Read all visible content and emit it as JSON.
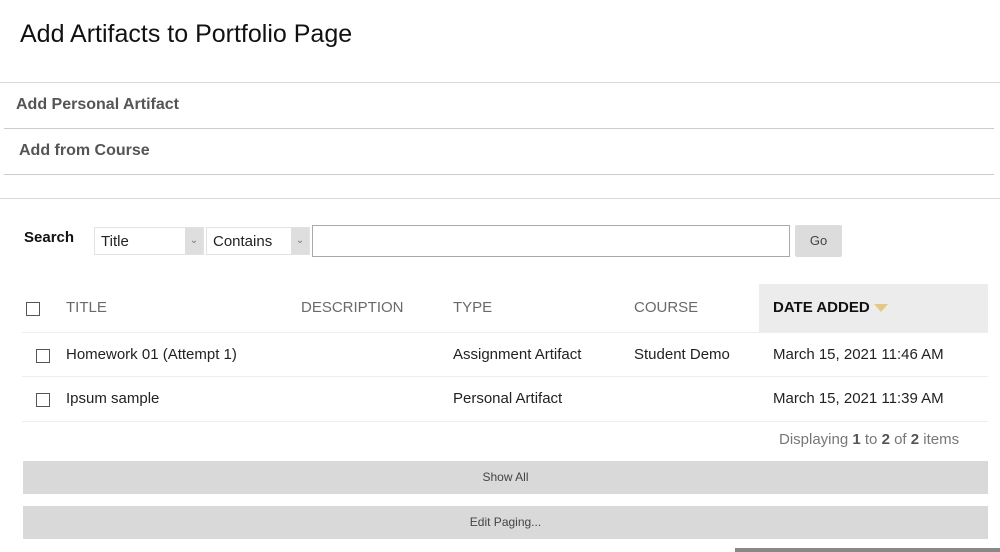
{
  "page": {
    "title": "Add Artifacts to Portfolio Page"
  },
  "actions": {
    "add_personal": "Add Personal Artifact",
    "add_from_course": "Add from Course"
  },
  "search": {
    "label": "Search",
    "field_select": "Title",
    "operator_select": "Contains",
    "input_value": "",
    "go_label": "Go"
  },
  "table": {
    "columns": [
      "TITLE",
      "DESCRIPTION",
      "TYPE",
      "COURSE",
      "DATE ADDED"
    ],
    "sorted_column": "DATE ADDED",
    "rows": [
      {
        "title": "Homework 01 (Attempt 1)",
        "description": "",
        "type": "Assignment Artifact",
        "course": "Student Demo",
        "date_added": "March 15, 2021 11:46 AM"
      },
      {
        "title": "Ipsum sample",
        "description": "",
        "type": "Personal Artifact",
        "course": "",
        "date_added": "March 15, 2021 11:39 AM"
      }
    ]
  },
  "paging": {
    "prefix": "Displaying",
    "from": "1",
    "to_word": "to",
    "to": "2",
    "of_word": "of",
    "total": "2",
    "suffix": "items",
    "show_all": "Show All",
    "edit_paging": "Edit Paging..."
  }
}
